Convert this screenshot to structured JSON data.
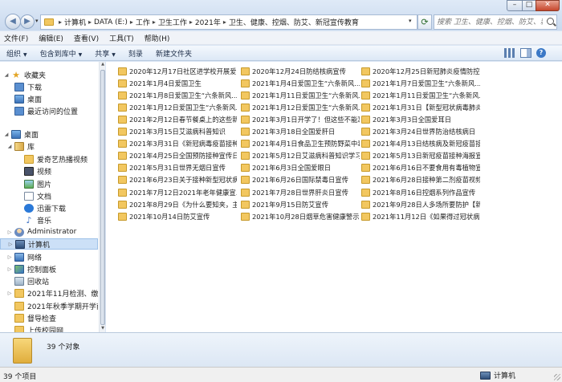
{
  "window": {
    "address_path": [
      "计算机",
      "DATA (E:)",
      "工作",
      "卫生工作",
      "2021年",
      "卫生、健康、控烟、防艾、新冠宣传教育"
    ],
    "search_placeholder": "搜索 卫生、健康、控烟、防艾、新冠...",
    "min_label": "–",
    "max_label": "□",
    "close_label": "✕"
  },
  "menu": [
    "文件(F)",
    "编辑(E)",
    "查看(V)",
    "工具(T)",
    "帮助(H)"
  ],
  "toolbar": [
    {
      "label": "组织",
      "has_caret": true
    },
    {
      "label": "包含到库中",
      "has_caret": true
    },
    {
      "label": "共享",
      "has_caret": true
    },
    {
      "label": "刻录",
      "has_caret": false
    },
    {
      "label": "新建文件夹",
      "has_caret": false
    }
  ],
  "sidebar": [
    {
      "label": "收藏夹",
      "icon": "star-icon",
      "indent": 0,
      "tri": "◢"
    },
    {
      "label": "下载",
      "icon": "download-folder-icon",
      "indent": 1
    },
    {
      "label": "桌面",
      "icon": "desktop-icon",
      "indent": 1
    },
    {
      "label": "最近访问的位置",
      "icon": "recent-places-icon",
      "indent": 1
    },
    {
      "label": "桌面",
      "icon": "desktop-icon",
      "indent": 0,
      "tri": "◢"
    },
    {
      "label": "库",
      "icon": "library-icon",
      "indent": 1,
      "tri": "◢"
    },
    {
      "label": "爱奇艺热播视频",
      "icon": "folder-icon",
      "indent": 2
    },
    {
      "label": "视频",
      "icon": "video-library-icon",
      "indent": 2
    },
    {
      "label": "图片",
      "icon": "pictures-library-icon",
      "indent": 2
    },
    {
      "label": "文档",
      "icon": "documents-library-icon",
      "indent": 2
    },
    {
      "label": "迅雷下载",
      "icon": "thunder-icon",
      "indent": 2
    },
    {
      "label": "音乐",
      "icon": "music-library-icon",
      "indent": 2
    },
    {
      "label": "Administrator",
      "icon": "user-icon",
      "indent": 1,
      "tri": "▷"
    },
    {
      "label": "计算机",
      "icon": "computer-icon",
      "indent": 1,
      "tri": "▷",
      "selected": true
    },
    {
      "label": "网络",
      "icon": "network-icon",
      "indent": 1,
      "tri": "▷"
    },
    {
      "label": "控制面板",
      "icon": "control-panel-icon",
      "indent": 1,
      "tri": "▷"
    },
    {
      "label": "回收站",
      "icon": "recycle-bin-icon",
      "indent": 1
    },
    {
      "label": "2021年11月检测、缴停",
      "icon": "folder-icon",
      "indent": 1,
      "tri": "▷"
    },
    {
      "label": "2021年秋季学期开学前防",
      "icon": "folder-icon",
      "indent": 1
    },
    {
      "label": "督导检查",
      "icon": "folder-icon",
      "indent": 1
    },
    {
      "label": "上传校园网",
      "icon": "folder-icon",
      "indent": 1
    }
  ],
  "files": [
    "2020年12月17日社区进学校开展爱...",
    "2020年12月24日防结核病宣传",
    "2020年12月25日新冠肺炎疫情防控...",
    "2021年1月4日爱国卫生",
    "2021年1月4日爱国卫生“六条新风...",
    "2021年1月7日爱国卫生“六条新风...",
    "2021年1月8日爱国卫生“六条新风...",
    "2021年1月11日爱国卫生“六条新风...",
    "2021年1月11日爱国卫生“六条新风...",
    "2021年1月12日爱国卫生“六条新风...",
    "2021年1月12日爱国卫生“六条新风...",
    "2021年1月31日【新型冠状病毒肺炎...",
    "2021年2月12日春节餐桌上的这些新...",
    "2021年3月1日开学了！但这些不能忘",
    "2021年3月3日全国爱耳日",
    "2021年3月15日艾滋病科普知识",
    "2021年3月18日全国爱肝日",
    "2021年3月24日世界防治结核病日",
    "2021年3月31日《新冠病毒疫苗接种...",
    "2021年4月1日食品卫生预防野菜中毒",
    "2021年4月13日结核病及新冠疫苗接...",
    "2021年4月25日全国预防接种宣传日",
    "2021年5月12日艾滋病科普知识学习",
    "2021年5月13日新冠疫苗接种海报宣...",
    "2021年5月31日世界无烟日宣传",
    "2021年6月3日全国爱眼日",
    "2021年6月16日不要食用有毒植物宣...",
    "2021年6月23日关于接种新型冠状病...",
    "2021年6月26日国际禁毒日宣传",
    "2021年6月28日接种第二剂疫苗视频",
    "2021年7月12日2021年老年健康宣...",
    "2021年7月28日世界肝炎日宣传",
    "2021年8月16日控烟系列作品宣传",
    "2021年8月29日《为什么要知夹，主...",
    "2021年9月15日防艾宣传",
    "2021年9月28日人多场所要防护【新...",
    "2021年10月14日防艾宣传",
    "2021年10月28日烟草危害健康警示",
    "2021年11月12日《如果得过冠状病..."
  ],
  "details": {
    "count_text": "39 个对象"
  },
  "status": {
    "count_text": "39 个项目",
    "location_label": "计算机"
  },
  "colors": {
    "selection": "#cce0f7",
    "folder": "#f2c760",
    "close": "#c6472d"
  }
}
